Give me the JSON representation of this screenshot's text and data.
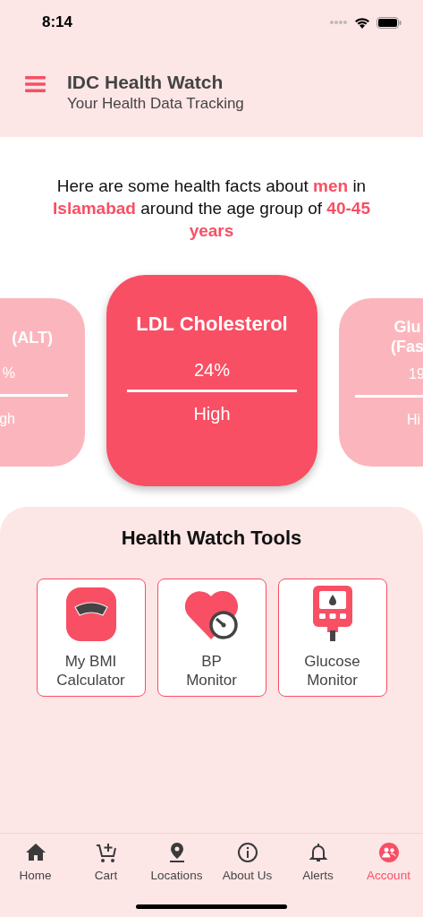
{
  "status_bar": {
    "time": "8:14"
  },
  "header": {
    "title": "IDC Health Watch",
    "subtitle": "Your Health Data Tracking"
  },
  "intro": "Here are some health facts about **men** in **Islamabad** around the age group of **40-45 years**",
  "facts": [
    {
      "title": "(ALT)",
      "value": "%",
      "status": "gh",
      "selected": false
    },
    {
      "title": "LDL Cholesterol",
      "value": "24%",
      "status": "High",
      "selected": true
    },
    {
      "title": "Glu\n(Fas",
      "value": "19",
      "status": "Hi",
      "selected": false
    }
  ],
  "tools": {
    "title": "Health Watch Tools",
    "items": [
      {
        "label": "My BMI\nCalculator",
        "kind": "scale"
      },
      {
        "label": "BP\nMonitor",
        "kind": "heart"
      },
      {
        "label": "Glucose\nMonitor",
        "kind": "meter"
      }
    ]
  },
  "nav": [
    {
      "label": "Home",
      "selected": false
    },
    {
      "label": "Cart",
      "selected": false
    },
    {
      "label": "Locations",
      "selected": false
    },
    {
      "label": "About Us",
      "selected": false
    },
    {
      "label": "Alerts",
      "selected": false
    },
    {
      "label": "Account",
      "selected": true
    }
  ]
}
